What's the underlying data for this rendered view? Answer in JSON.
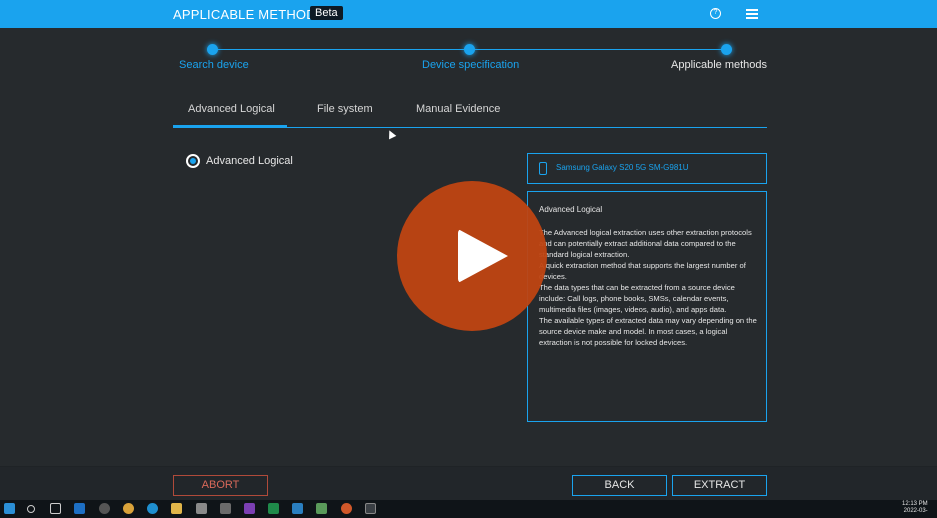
{
  "header": {
    "title": "APPLICABLE METHODS",
    "badge": "Beta",
    "help_icon": "help-icon",
    "menu_icon": "hamburger-menu-icon"
  },
  "stepper": {
    "steps": [
      {
        "label": "Search device"
      },
      {
        "label": "Device specification"
      },
      {
        "label": "Applicable methods"
      }
    ],
    "current_index": 2
  },
  "tabs": [
    {
      "label": "Advanced Logical",
      "active": true
    },
    {
      "label": "File system"
    },
    {
      "label": "Manual Evidence"
    }
  ],
  "methods": {
    "selected_label": "Advanced Logical"
  },
  "device": {
    "name": "Samsung Galaxy S20 5G SM-G981U",
    "icon": "phone-icon"
  },
  "description": {
    "title": "Advanced Logical",
    "body": "The Advanced logical extraction uses other extraction protocols and can potentially extract additional data compared to the standard logical extraction.\nA quick extraction method that supports the largest number of devices.\nThe data types that can be extracted from a source device include: Call logs, phone books, SMSs, calendar events, multimedia files (images, videos, audio), and apps data.\nThe available types of extracted data may vary depending on the source device make and model. In most cases, a logical extraction is not possible for locked devices."
  },
  "buttons": {
    "abort": "ABORT",
    "back": "BACK",
    "extract": "EXTRACT"
  },
  "overlay": {
    "icon": "play-icon",
    "color": "#bf4412"
  },
  "taskbar": {
    "clock_time": "12:13 PM",
    "clock_date": "2022-03-",
    "icons": [
      "windows-start-icon",
      "search-icon",
      "task-view-icon",
      "outlook-icon",
      "app-icon",
      "chrome-icon",
      "edge-icon",
      "folder-icon",
      "app-icon",
      "app-icon",
      "onenote-icon",
      "excel-icon",
      "app-icon",
      "notepad-icon",
      "powerpoint-icon",
      "app-icon"
    ]
  },
  "colors": {
    "accent": "#1aa3ee",
    "background": "#262a2d",
    "abort": "#b04a3a"
  }
}
